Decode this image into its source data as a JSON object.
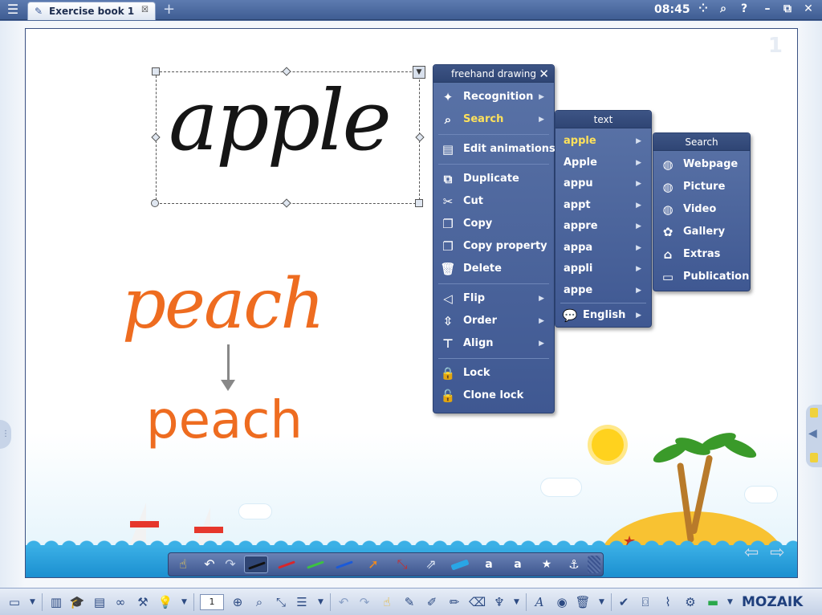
{
  "titlebar": {
    "tab_label": "Exercise book 1",
    "tab_close": "☒",
    "add_tab": "+",
    "time": "08:45",
    "grid_icon": "⁘",
    "search_icon": "⌕",
    "help_label": "?",
    "minimize_label": "–",
    "restore_label": "⧉",
    "close_label": "✕"
  },
  "canvas": {
    "page_number": "1",
    "handwritten_word": "apple",
    "handwritten_word_2": "peach",
    "converted_word": "peach"
  },
  "main_menu": {
    "title": "freehand drawing",
    "items": [
      {
        "label": "Recognition",
        "icon": "wand-icon",
        "glyph": "✦",
        "submenu": "▶"
      },
      {
        "label": "Search",
        "icon": "magnifier-icon",
        "glyph": "⌕",
        "submenu": "▶"
      },
      {
        "label": "Edit animations",
        "icon": "clapper-icon",
        "glyph": "🎬"
      },
      {
        "label": "Duplicate",
        "icon": "duplicate-icon",
        "glyph": "⧉"
      },
      {
        "label": "Cut",
        "icon": "scissors-icon",
        "glyph": "✂"
      },
      {
        "label": "Copy",
        "icon": "copy-icon",
        "glyph": "❐"
      },
      {
        "label": "Copy property",
        "icon": "copy-property-icon",
        "glyph": "❐"
      },
      {
        "label": "Delete",
        "icon": "trash-icon",
        "glyph": "🗑"
      },
      {
        "label": "Flip",
        "icon": "flip-icon",
        "glyph": "◁▷",
        "submenu": "▶"
      },
      {
        "label": "Order",
        "icon": "order-icon",
        "glyph": "⇳",
        "submenu": "▶"
      },
      {
        "label": "Align",
        "icon": "align-icon",
        "glyph": "⊤",
        "submenu": "▶"
      },
      {
        "label": "Lock",
        "icon": "lock-icon",
        "glyph": "🔒"
      },
      {
        "label": "Clone lock",
        "icon": "clone-lock-icon",
        "glyph": "🔓"
      }
    ]
  },
  "text_menu": {
    "title": "text",
    "items": [
      {
        "label": "apple",
        "submenu": "▶"
      },
      {
        "label": "Apple",
        "submenu": "▶"
      },
      {
        "label": "appu",
        "submenu": "▶"
      },
      {
        "label": "appt",
        "submenu": "▶"
      },
      {
        "label": "appre",
        "submenu": "▶"
      },
      {
        "label": "appa",
        "submenu": "▶"
      },
      {
        "label": "appli",
        "submenu": "▶"
      },
      {
        "label": "appe",
        "submenu": "▶"
      }
    ],
    "language": "English",
    "language_submenu": "▶"
  },
  "search_menu": {
    "title": "Search",
    "items": [
      {
        "label": "Webpage",
        "icon": "globe-icon",
        "glyph": "🌐"
      },
      {
        "label": "Picture",
        "icon": "globe-icon",
        "glyph": "🌐"
      },
      {
        "label": "Video",
        "icon": "globe-icon",
        "glyph": "🌐"
      },
      {
        "label": "Gallery",
        "icon": "flower-icon",
        "glyph": "✿"
      },
      {
        "label": "Extras",
        "icon": "museum-icon",
        "glyph": "🏛"
      },
      {
        "label": "Publication",
        "icon": "book-icon",
        "glyph": "📖"
      }
    ]
  },
  "bottombar": {
    "page_number": "1",
    "brand": "MOZAIK"
  },
  "colors": {
    "menu_bg": "#4a64a0",
    "highlight": "#ffe25b",
    "orange_ink": "#ee6c20",
    "black_ink": "#151515"
  }
}
